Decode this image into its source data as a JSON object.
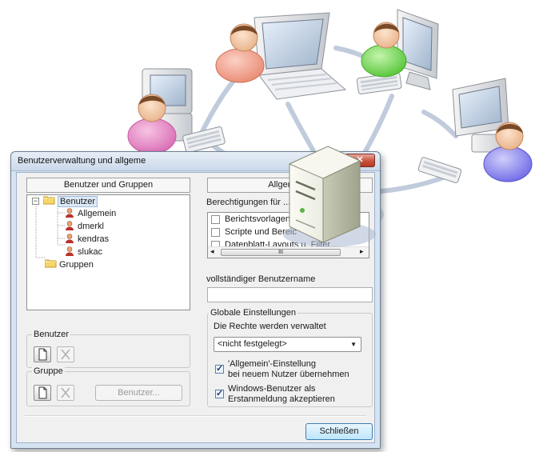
{
  "window": {
    "title": "Benutzerverwaltung und allgeme",
    "close_glyph": "✕"
  },
  "left_panel": {
    "header": "Benutzer und Gruppen",
    "tree": {
      "root_label": "Benutzer",
      "root_expander": "−",
      "users": [
        "Allgemein",
        "dmerkl",
        "kendras",
        "slukac"
      ],
      "groups_label": "Gruppen"
    },
    "benutzer_group": {
      "label": "Benutzer"
    },
    "gruppe_group": {
      "label": "Gruppe",
      "benutzer_button": "Benutzer..."
    }
  },
  "right_panel": {
    "header": "Allgemeine",
    "permissions_label": "Berechtigungen für ...",
    "permissions": [
      {
        "label": "Berichtsvorlagen",
        "checked": false
      },
      {
        "label": "Scripte und Bereic",
        "checked": false
      },
      {
        "label": "Datenblatt-Layouts u. Filter",
        "checked": false
      }
    ],
    "scrollbar": {
      "left": "◂",
      "thumb": "III",
      "right": "▸"
    },
    "fullname_label": "vollständiger Benutzername",
    "fullname_value": "",
    "global": {
      "label": "Globale Einstellungen",
      "managed_label": "Die Rechte werden verwaltet",
      "managed_value": "<nicht festgelegt>",
      "option1_line1": "'Allgemein'-Einstellung",
      "option1_line2": "bei neuem Nutzer übernehmen",
      "option1_checked": true,
      "option2_line1": "Windows-Benutzer als",
      "option2_line2": "Erstanmeldung akzeptieren",
      "option2_checked": true
    }
  },
  "footer": {
    "close_button": "Schließen"
  },
  "icons": [
    "laptop-icon",
    "monitor-icon",
    "desktop-computer-icon",
    "server-icon",
    "user-avatar-icon",
    "folder-icon",
    "user-icon",
    "new-document-icon",
    "delete-icon",
    "chevron-down-icon",
    "checkbox-icon"
  ],
  "colors": {
    "avatar_pink": "#e88dc5",
    "avatar_salmon": "#f29e8a",
    "avatar_green": "#7bdc5e",
    "avatar_purple": "#8f8bf0",
    "network_line": "#b6c3d6",
    "dialog_frame": "#d6e3f1",
    "close_red": "#c7513d",
    "default_button": "#3c7fb1"
  }
}
